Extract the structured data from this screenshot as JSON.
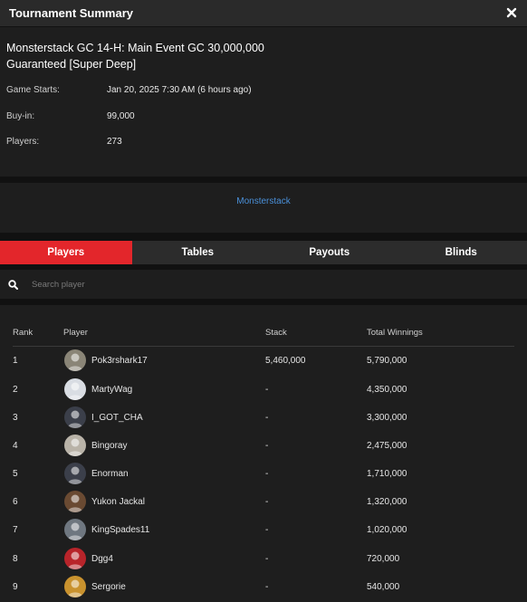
{
  "window": {
    "title": "Tournament Summary",
    "close_icon": "close-icon"
  },
  "event": {
    "name": "Monsterstack GC 14-H: Main Event GC 30,000,000 Guaranteed [Super Deep]",
    "game_starts_label": "Game Starts:",
    "game_starts_value": "Jan 20, 2025 7:30 AM (6 hours ago)",
    "buyin_label": "Buy-in:",
    "buyin_value": "99,000",
    "players_label": "Players:",
    "players_value": "273"
  },
  "banner": {
    "link": "Monsterstack"
  },
  "tabs": [
    {
      "label": "Players",
      "active": true
    },
    {
      "label": "Tables",
      "active": false
    },
    {
      "label": "Payouts",
      "active": false
    },
    {
      "label": "Blinds",
      "active": false
    }
  ],
  "search": {
    "placeholder": "Search player",
    "icon": "search-icon"
  },
  "table": {
    "headers": {
      "rank": "Rank",
      "player": "Player",
      "stack": "Stack",
      "winnings": "Total Winnings"
    },
    "rows": [
      {
        "rank": "1",
        "player": "Pok3rshark17",
        "stack": "5,460,000",
        "winnings": "5,790,000",
        "avatar_color": "#8a8577"
      },
      {
        "rank": "2",
        "player": "MartyWag",
        "stack": "-",
        "winnings": "4,350,000",
        "avatar_color": "#d9dde3"
      },
      {
        "rank": "3",
        "player": "I_GOT_CHA",
        "stack": "-",
        "winnings": "3,300,000",
        "avatar_color": "#3b3f4a"
      },
      {
        "rank": "4",
        "player": "Bingoray",
        "stack": "-",
        "winnings": "2,475,000",
        "avatar_color": "#b9b3a8"
      },
      {
        "rank": "5",
        "player": "Enorman",
        "stack": "-",
        "winnings": "1,710,000",
        "avatar_color": "#3b3f4a"
      },
      {
        "rank": "6",
        "player": "Yukon Jackal",
        "stack": "-",
        "winnings": "1,320,000",
        "avatar_color": "#6a4a32"
      },
      {
        "rank": "7",
        "player": "KingSpades11",
        "stack": "-",
        "winnings": "1,020,000",
        "avatar_color": "#6f7780"
      },
      {
        "rank": "8",
        "player": "Dgg4",
        "stack": "-",
        "winnings": "720,000",
        "avatar_color": "#b8242a"
      },
      {
        "rank": "9",
        "player": "Sergorie",
        "stack": "-",
        "winnings": "540,000",
        "avatar_color": "#c9922e"
      }
    ]
  }
}
